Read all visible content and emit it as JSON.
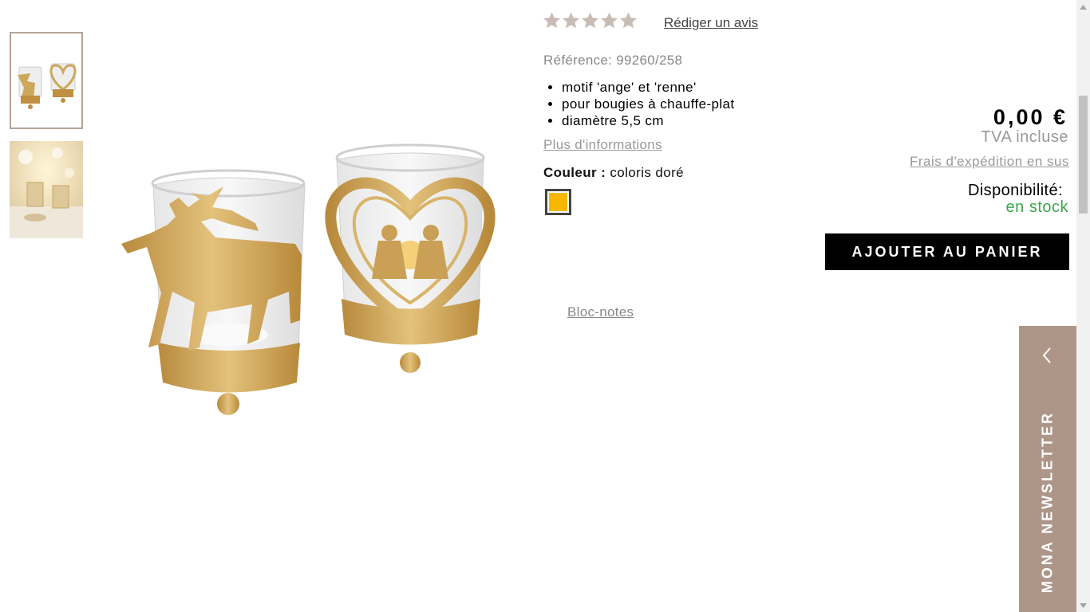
{
  "product": {
    "rating": {
      "stars_filled": 0,
      "stars_total": 5,
      "write_review": "Rédiger un avis"
    },
    "reference_label": "Référence:",
    "reference_value": "99260/258",
    "features": [
      "motif 'ange' et 'renne'",
      "pour bougies à chauffe-plat",
      "diamètre 5,5 cm"
    ],
    "more_info": "Plus d'informations",
    "color_label": "Couleur :",
    "color_value": "coloris doré",
    "swatch_color": "#f6b800",
    "notepad": "Bloc-notes"
  },
  "purchase": {
    "price": "0,00 €",
    "vat": "TVA incluse",
    "shipping": "Frais d'expédition en sus",
    "availability_label": "Disponibilité:",
    "availability_value": "en stock",
    "availability_color": "#3aa64a",
    "add_to_cart": "AJOUTER AU PANIER"
  },
  "newsletter": {
    "label": "MONA NEWSLETTER",
    "icon": "chevron-left-icon",
    "color": "#ad9688"
  },
  "gallery": {
    "thumbnails": [
      "product-thumbnail",
      "ambiance-thumbnail"
    ],
    "selected": 0
  },
  "colors": {
    "gold": "#cda75a",
    "star": "#c8bcb5",
    "button": "#000000"
  }
}
